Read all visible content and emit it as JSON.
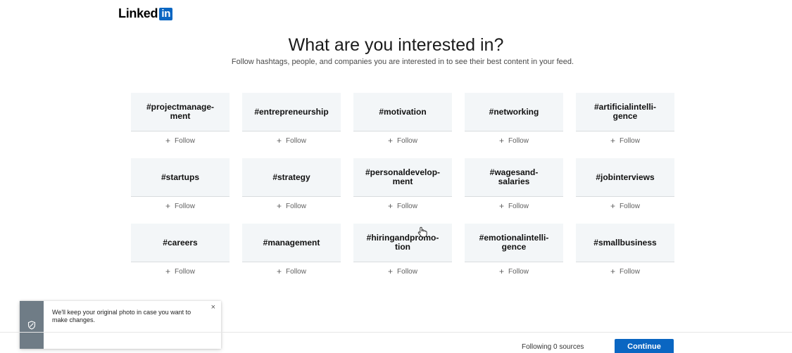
{
  "logo": {
    "text": "Linked",
    "badge": "in",
    "brand_color": "#0a66c2"
  },
  "heading": {
    "title": "What are you interested in?",
    "subtitle": "Follow hashtags, people, and companies you are interested in to see their best content in your feed."
  },
  "follow_label": "Follow",
  "hashtags": [
    "#projectmanage-\nment",
    "#entrepreneurship",
    "#motivation",
    "#networking",
    "#artificialintelli-\ngence",
    "#startups",
    "#strategy",
    "#personaldevelop-\nment",
    "#wagesand-\nsalaries",
    "#jobinterviews",
    "#careers",
    "#management",
    "#hiringandpromo-\ntion",
    "#emotionalintelli-\ngence",
    "#smallbusiness"
  ],
  "footer": {
    "following_text": "Following 0 sources",
    "continue_label": "Continue"
  },
  "toast": {
    "message": "We'll keep your original photo in case you want to make changes.",
    "close_glyph": "×",
    "icon": "shield-icon"
  }
}
